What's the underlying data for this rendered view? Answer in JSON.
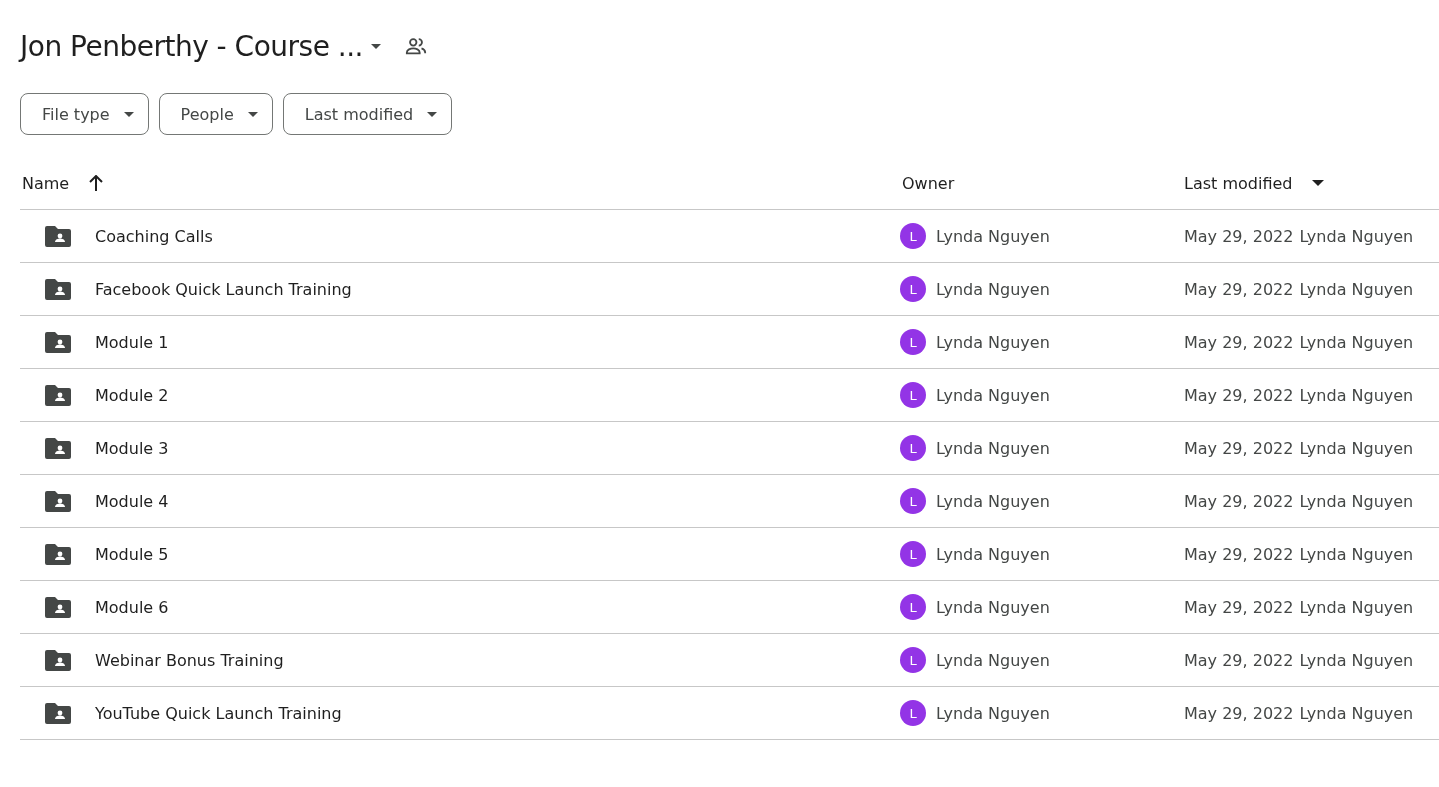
{
  "header": {
    "title": "Jon Penberthy - Course ..."
  },
  "filters": [
    {
      "label": "File type"
    },
    {
      "label": "People"
    },
    {
      "label": "Last modified"
    }
  ],
  "table": {
    "columns": [
      {
        "label": "Name",
        "kind": "arrow"
      },
      {
        "label": "Owner",
        "kind": "plain"
      },
      {
        "label": "Last modified",
        "kind": "caret"
      }
    ],
    "rows": [
      {
        "name": "Coaching Calls",
        "owner_initial": "L",
        "owner": "Lynda Nguyen",
        "modified_date": "May 29, 2022",
        "modified_by": "Lynda Nguyen"
      },
      {
        "name": "Facebook Quick Launch Training",
        "owner_initial": "L",
        "owner": "Lynda Nguyen",
        "modified_date": "May 29, 2022",
        "modified_by": "Lynda Nguyen"
      },
      {
        "name": "Module 1",
        "owner_initial": "L",
        "owner": "Lynda Nguyen",
        "modified_date": "May 29, 2022",
        "modified_by": "Lynda Nguyen"
      },
      {
        "name": "Module 2",
        "owner_initial": "L",
        "owner": "Lynda Nguyen",
        "modified_date": "May 29, 2022",
        "modified_by": "Lynda Nguyen"
      },
      {
        "name": "Module 3",
        "owner_initial": "L",
        "owner": "Lynda Nguyen",
        "modified_date": "May 29, 2022",
        "modified_by": "Lynda Nguyen"
      },
      {
        "name": "Module 4",
        "owner_initial": "L",
        "owner": "Lynda Nguyen",
        "modified_date": "May 29, 2022",
        "modified_by": "Lynda Nguyen"
      },
      {
        "name": "Module 5",
        "owner_initial": "L",
        "owner": "Lynda Nguyen",
        "modified_date": "May 29, 2022",
        "modified_by": "Lynda Nguyen"
      },
      {
        "name": "Module 6",
        "owner_initial": "L",
        "owner": "Lynda Nguyen",
        "modified_date": "May 29, 2022",
        "modified_by": "Lynda Nguyen"
      },
      {
        "name": "Webinar Bonus Training",
        "owner_initial": "L",
        "owner": "Lynda Nguyen",
        "modified_date": "May 29, 2022",
        "modified_by": "Lynda Nguyen"
      },
      {
        "name": "YouTube Quick Launch Training",
        "owner_initial": "L",
        "owner": "Lynda Nguyen",
        "modified_date": "May 29, 2022",
        "modified_by": "Lynda Nguyen"
      }
    ]
  }
}
